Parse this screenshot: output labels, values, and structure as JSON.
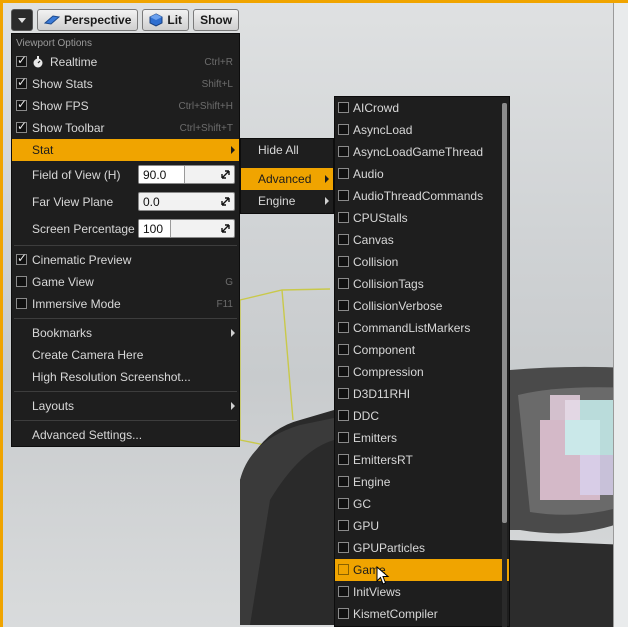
{
  "toolbar": {
    "perspective_label": "Perspective",
    "lit_label": "Lit",
    "show_label": "Show"
  },
  "viewport_menu": {
    "header": "Viewport Options",
    "realtime": {
      "label": "Realtime",
      "shortcut": "Ctrl+R",
      "checked": true
    },
    "show_stats": {
      "label": "Show Stats",
      "shortcut": "Shift+L",
      "checked": true
    },
    "show_fps": {
      "label": "Show FPS",
      "shortcut": "Ctrl+Shift+H",
      "checked": true
    },
    "show_toolbar": {
      "label": "Show Toolbar",
      "shortcut": "Ctrl+Shift+T",
      "checked": true
    },
    "stat": {
      "label": "Stat"
    },
    "fov": {
      "label": "Field of View (H)",
      "value": "90.0"
    },
    "far_plane": {
      "label": "Far View Plane",
      "value": "0.0"
    },
    "screen_pct": {
      "label": "Screen Percentage",
      "value": "100"
    },
    "cinematic_preview": {
      "label": "Cinematic Preview",
      "checked": true
    },
    "game_view": {
      "label": "Game View",
      "shortcut": "G",
      "checked": false
    },
    "immersive_mode": {
      "label": "Immersive Mode",
      "shortcut": "F11",
      "checked": false
    },
    "bookmarks": "Bookmarks",
    "create_camera": "Create Camera Here",
    "hires_screenshot": "High Resolution Screenshot...",
    "layouts": "Layouts",
    "advanced_settings": "Advanced Settings..."
  },
  "stat_menu": {
    "hide_all": "Hide All",
    "advanced": "Advanced",
    "engine": "Engine"
  },
  "advanced_menu": {
    "items": [
      "AICrowd",
      "AsyncLoad",
      "AsyncLoadGameThread",
      "Audio",
      "AudioThreadCommands",
      "CPUStalls",
      "Canvas",
      "Collision",
      "CollisionTags",
      "CollisionVerbose",
      "CommandListMarkers",
      "Component",
      "Compression",
      "D3D11RHI",
      "DDC",
      "Emitters",
      "EmittersRT",
      "Engine",
      "GC",
      "GPU",
      "GPUParticles",
      "Game",
      "InitViews",
      "KismetCompiler"
    ],
    "highlighted": "Game"
  },
  "colors": {
    "accent": "#f0a400",
    "menu_bg": "#1e1e1e"
  }
}
